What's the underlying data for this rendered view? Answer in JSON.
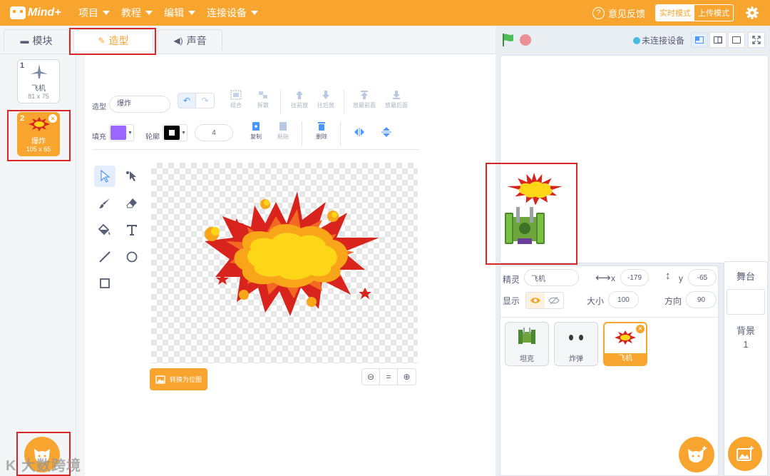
{
  "menubar": {
    "logo": "Mind+",
    "menus": [
      "项目",
      "教程",
      "编辑",
      "连接设备"
    ],
    "feedback": "意见反馈",
    "mode_realtime": "实时模式",
    "mode_upload": "上传模式"
  },
  "tabs": {
    "blocks": "模块",
    "costumes": "造型",
    "sounds": "声音"
  },
  "costumes": [
    {
      "index": "1",
      "name": "飞机",
      "size": "81 x 75"
    },
    {
      "index": "2",
      "name": "爆炸",
      "size": "105 x 65"
    }
  ],
  "editor": {
    "costume_label": "造型",
    "costume_name": "爆炸",
    "fill_label": "填充",
    "outline_label": "轮廓",
    "outline_width": "4",
    "fill_color": "#9966ff",
    "outline_color": "#000000",
    "group": "组合",
    "ungroup": "拆散",
    "forward": "往前放",
    "backward": "往后放",
    "front": "放最前面",
    "back": "放最后面",
    "copy": "复制",
    "paste": "粘贴",
    "delete": "删除",
    "convert_bitmap": "转换为位图"
  },
  "stage": {
    "connection": "未连接设备"
  },
  "sprite_info": {
    "sprite_label": "精灵",
    "sprite_name": "飞机",
    "x_label": "x",
    "x_value": "-179",
    "y_label": "y",
    "y_value": "-65",
    "show_label": "显示",
    "size_label": "大小",
    "size_value": "100",
    "direction_label": "方向",
    "direction_value": "90"
  },
  "sprites": [
    {
      "name": "坦克"
    },
    {
      "name": "炸弹"
    },
    {
      "name": "飞机"
    }
  ],
  "stage_side": {
    "title": "舞台",
    "backdrop_label": "背景",
    "backdrop_count": "1"
  },
  "watermark": "K 大数跨境",
  "colors": {
    "accent": "#f8a530",
    "highlight_box": "#d92727",
    "selection_blue": "#4c97ff"
  }
}
